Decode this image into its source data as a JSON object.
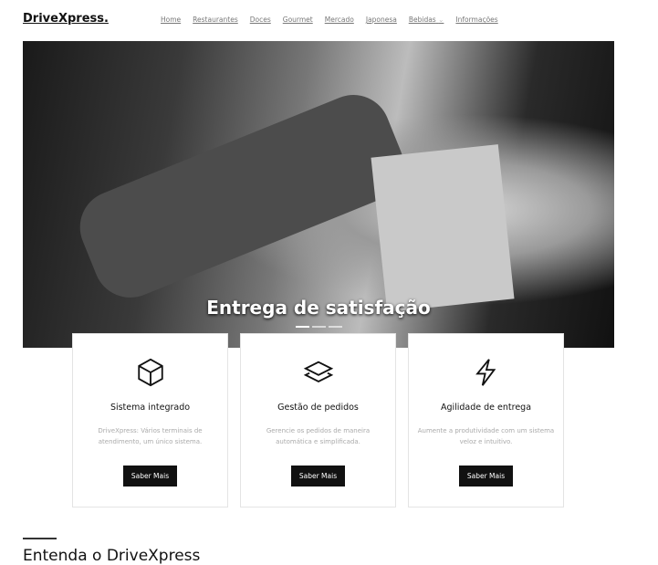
{
  "header": {
    "brand": "DriveXpress.",
    "nav": [
      "Home",
      "Restaurantes",
      "Doces",
      "Gourmet",
      "Mercado",
      "Japonesa",
      "Bebidas",
      "Informações"
    ]
  },
  "hero": {
    "caption": "Entrega de satisfação",
    "slides": 3,
    "active_slide": 1
  },
  "features": [
    {
      "icon": "cube-icon",
      "title": "Sistema integrado",
      "text": "DriveXpress: Vários terminais de atendimento, um único sistema.",
      "button": "Saber Mais"
    },
    {
      "icon": "layers-icon",
      "title": "Gestão de pedidos",
      "text": "Gerencie os pedidos de maneira automática e simplificada.",
      "button": "Saber Mais"
    },
    {
      "icon": "lightning-icon",
      "title": "Agilidade de entrega",
      "text": "Aumente a produtividade com um sistema veloz e intuitivo.",
      "button": "Saber Mais"
    }
  ],
  "section": {
    "title": "Entenda o DriveXpress"
  }
}
